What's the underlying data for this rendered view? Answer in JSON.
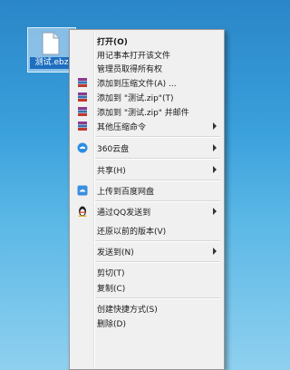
{
  "desktop": {
    "file_name": "测试.ebz"
  },
  "menu": {
    "items": [
      {
        "label": "打开(O)",
        "icon": "",
        "submenu": false,
        "bold": true
      },
      {
        "label": "用记事本打开该文件",
        "icon": "",
        "submenu": false
      },
      {
        "label": "管理员取得所有权",
        "icon": "",
        "submenu": false
      },
      {
        "label": "添加到压缩文件(A) ...",
        "icon": "winrar-icon",
        "submenu": false
      },
      {
        "label": "添加到 \"测试.zip\"(T)",
        "icon": "winrar-icon",
        "submenu": false
      },
      {
        "label": "添加到 \"测试.zip\" 并邮件",
        "icon": "winrar-icon",
        "submenu": false
      },
      {
        "label": "其他压缩命令",
        "icon": "winrar-icon",
        "submenu": true
      },
      {
        "label": "360云盘",
        "icon": "cloud-360-icon",
        "submenu": true
      },
      {
        "label": "共享(H)",
        "icon": "",
        "submenu": true
      },
      {
        "label": "上传到百度网盘",
        "icon": "baidu-netdisk-icon",
        "submenu": false
      },
      {
        "label": "通过QQ发送到",
        "icon": "qq-penguin-icon",
        "submenu": true
      },
      {
        "label": "还原以前的版本(V)",
        "icon": "",
        "submenu": false
      },
      {
        "label": "发送到(N)",
        "icon": "",
        "submenu": true
      },
      {
        "label": "剪切(T)",
        "icon": "",
        "submenu": false
      },
      {
        "label": "复制(C)",
        "icon": "",
        "submenu": false
      },
      {
        "label": "创建快捷方式(S)",
        "icon": "",
        "submenu": false
      },
      {
        "label": "删除(D)",
        "icon": "",
        "submenu": false
      }
    ]
  },
  "colors": {
    "menu_bg": "#f0f0f0",
    "menu_border": "#979797"
  }
}
